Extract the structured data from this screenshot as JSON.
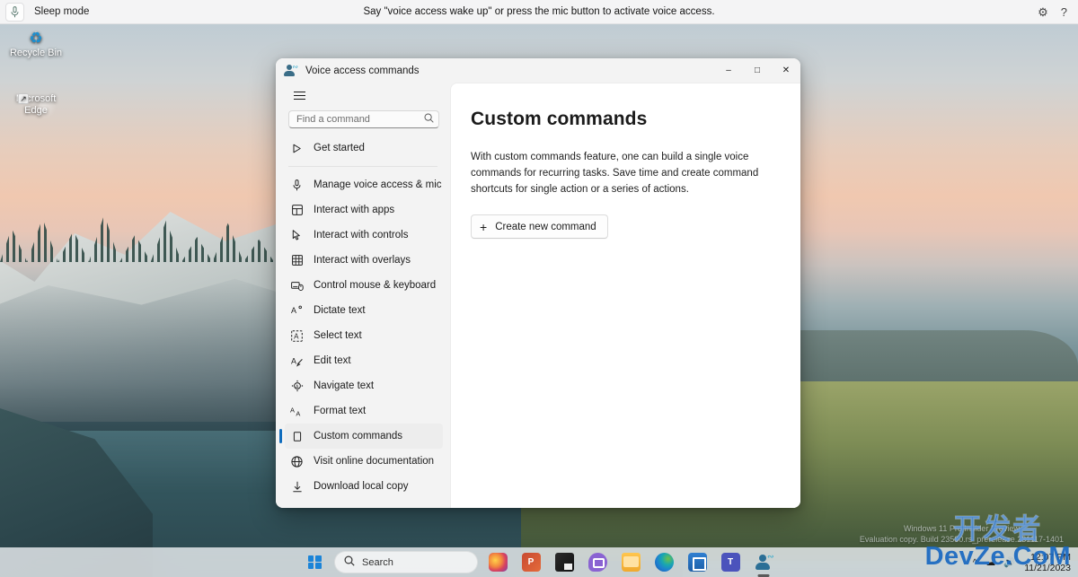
{
  "voice_access_bar": {
    "mic_icon": "microphone-icon",
    "mode_label": "Sleep mode",
    "hint": "Say \"voice access wake up\" or press the mic button to activate voice access.",
    "settings_icon": "gear-icon",
    "help_icon": "question-mark-icon"
  },
  "desktop": {
    "icons": [
      {
        "name": "recycle-bin",
        "label": "Recycle Bin"
      },
      {
        "name": "microsoft-edge",
        "label": "Microsoft\nEdge"
      }
    ]
  },
  "window": {
    "title": "Voice access commands",
    "icon": "voice-access-icon",
    "controls": {
      "minimize": "–",
      "maximize": "□",
      "close": "✕"
    }
  },
  "sidebar": {
    "hamburger": "navigation-menu-icon",
    "search": {
      "placeholder": "Find a command",
      "value": "",
      "icon": "search-icon"
    },
    "items": [
      {
        "label": "Get started",
        "icon": "play-icon",
        "selected": false
      },
      {
        "label": "Manage voice access & mic",
        "icon": "microphone-icon",
        "selected": false
      },
      {
        "label": "Interact with apps",
        "icon": "apps-grid-icon",
        "selected": false
      },
      {
        "label": "Interact with controls",
        "icon": "cursor-icon",
        "selected": false
      },
      {
        "label": "Interact with overlays",
        "icon": "grid-icon",
        "selected": false
      },
      {
        "label": "Control mouse & keyboard",
        "icon": "mouse-keyboard-icon",
        "selected": false
      },
      {
        "label": "Dictate text",
        "icon": "dictate-icon",
        "selected": false
      },
      {
        "label": "Select text",
        "icon": "select-text-icon",
        "selected": false
      },
      {
        "label": "Edit text",
        "icon": "edit-text-icon",
        "selected": false
      },
      {
        "label": "Navigate text",
        "icon": "navigate-text-icon",
        "selected": false
      },
      {
        "label": "Format text",
        "icon": "format-text-icon",
        "selected": false
      },
      {
        "label": "Custom commands",
        "icon": "custom-command-icon",
        "selected": true
      }
    ],
    "bottom_items": [
      {
        "label": "Visit online documentation",
        "icon": "globe-icon"
      },
      {
        "label": "Download local copy",
        "icon": "download-icon"
      }
    ]
  },
  "content": {
    "title": "Custom commands",
    "description": "With custom commands feature, one can build a single voice commands for recurring tasks. Save time and create command shortcuts for single action or a series of actions.",
    "create_button": {
      "label": "Create new command",
      "icon": "plus-icon"
    }
  },
  "eval_watermark": {
    "line1": "Windows 11 Pro Insider Preview",
    "line2": "Evaluation copy. Build 23580.rs_prerelease.231117-1401"
  },
  "taskbar": {
    "start_label": "start-button",
    "search": {
      "placeholder": "Search",
      "icon": "search-icon"
    },
    "apps": [
      {
        "name": "paint-app",
        "label": "Paint"
      },
      {
        "name": "powerpoint-app",
        "label": "PowerPoint"
      },
      {
        "name": "file-explorer-dark-app",
        "label": "Explorer"
      },
      {
        "name": "chat-app",
        "label": "Chat"
      },
      {
        "name": "file-explorer-app",
        "label": "File Explorer"
      },
      {
        "name": "microsoft-edge-app",
        "label": "Microsoft Edge"
      },
      {
        "name": "microsoft-store-app",
        "label": "Microsoft Store"
      },
      {
        "name": "microsoft-teams-app",
        "label": "Microsoft Teams"
      },
      {
        "name": "voice-access-app",
        "label": "Voice access"
      }
    ],
    "tray": {
      "chevron": "show-hidden-icons-chevron",
      "clock_time": "12:07 PM",
      "clock_date": "11/21/2023"
    }
  },
  "site_watermark": {
    "cn": "开发者",
    "en": "DevZe.CoM"
  },
  "colors": {
    "accent": "#0f6cbd",
    "window_bg": "#f3f3f3",
    "content_bg": "#ffffff",
    "text": "#1b1b1b"
  }
}
